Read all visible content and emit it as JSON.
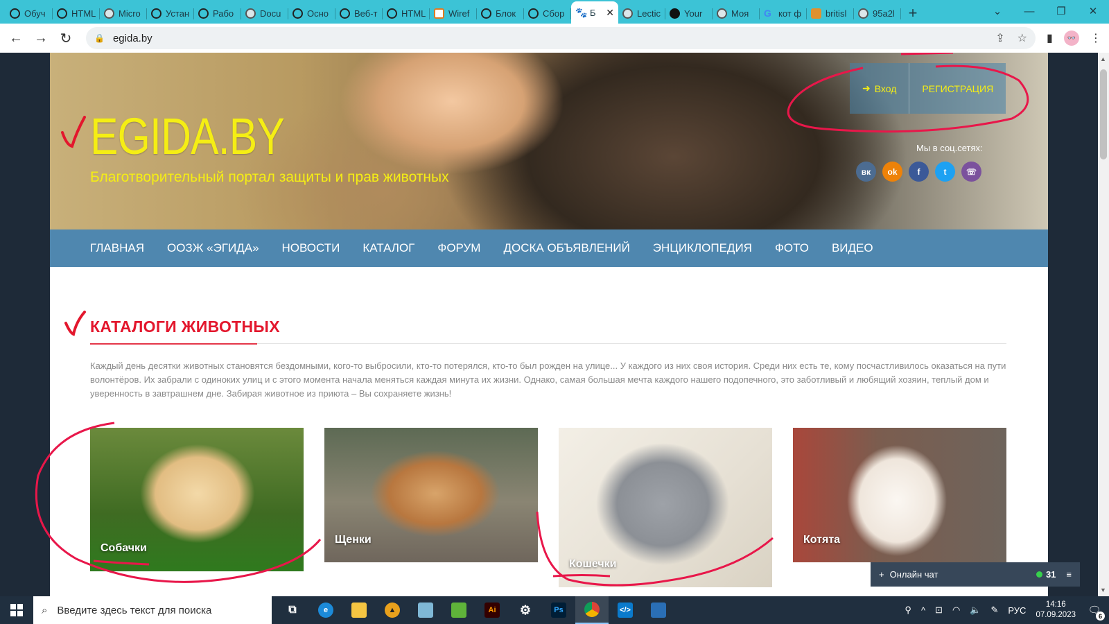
{
  "browser": {
    "tabs": [
      {
        "label": "Обуч",
        "icon": "openai-icon"
      },
      {
        "label": "HTML",
        "icon": "openai-icon"
      },
      {
        "label": "Micro",
        "icon": "globe-icon"
      },
      {
        "label": "Устан",
        "icon": "openai-icon"
      },
      {
        "label": "Рабо",
        "icon": "openai-icon"
      },
      {
        "label": "Docu",
        "icon": "globe-icon"
      },
      {
        "label": "Осно",
        "icon": "openai-icon"
      },
      {
        "label": "Веб-т",
        "icon": "openai-icon"
      },
      {
        "label": "HTML",
        "icon": "openai-icon"
      },
      {
        "label": "Wiref",
        "icon": "wireframe-icon"
      },
      {
        "label": "Блок",
        "icon": "openai-icon"
      },
      {
        "label": "Сбор",
        "icon": "openai-icon"
      },
      {
        "label": "Б",
        "icon": "paw-icon",
        "active": true
      },
      {
        "label": "Lectic",
        "icon": "globe-icon"
      },
      {
        "label": "Your",
        "icon": "github-icon"
      },
      {
        "label": "Моя",
        "icon": "globe-icon"
      },
      {
        "label": "кот ф",
        "icon": "google-icon"
      },
      {
        "label": "britisl",
        "icon": "tiger-icon"
      },
      {
        "label": "95a2l",
        "icon": "globe-icon"
      }
    ],
    "new_tab": "+",
    "url": "egida.by"
  },
  "site": {
    "logo": "EGIDA.BY",
    "tagline": "Благотворительный портал защиты и прав животных",
    "auth": {
      "login": "Вход",
      "register": "РЕГИСТРАЦИЯ"
    },
    "social_label": "Мы в соц.сетях:",
    "social": [
      {
        "name": "vk",
        "glyph": "вк",
        "color": "#4c6c91"
      },
      {
        "name": "odnoklassniki",
        "glyph": "ok",
        "color": "#ee8208"
      },
      {
        "name": "facebook",
        "glyph": "f",
        "color": "#3b5998"
      },
      {
        "name": "twitter",
        "glyph": "t",
        "color": "#1da1f2"
      },
      {
        "name": "viber",
        "glyph": "☏",
        "color": "#7b519d"
      }
    ],
    "menu": [
      "ГЛАВНАЯ",
      "ООЗЖ «ЭГИДА»",
      "НОВОСТИ",
      "КАТАЛОГ",
      "ФОРУМ",
      "ДОСКА ОБЪЯВЛЕНИЙ",
      "ЭНЦИКЛОПЕДИЯ",
      "ФОТО",
      "ВИДЕО"
    ],
    "section_title": "КАТАЛОГИ ЖИВОТНЫХ",
    "intro": "Каждый день десятки животных становятся бездомными, кого-то выбросили, кто-то потерялся, кто-то был рожден на улице... У каждого из них своя история. Среди них есть те, кому посчастливилось оказаться на пути волонтёров. Их забрали с одиноких улиц и с этого момента начала меняться каждая минута их жизни. Однако, самая большая мечта каждого нашего подопечного, это заботливый и любящий хозяин, теплый дом и уверенность в завтрашнем дне. Забирая животное из приюта – Вы сохраняете жизнь!",
    "cards": [
      {
        "label": "Собачки"
      },
      {
        "label": "Щенки"
      },
      {
        "label": "Кошечки"
      },
      {
        "label": "Котята"
      }
    ],
    "chat": {
      "label": "Онлайн чат",
      "count": "31"
    },
    "colors": {
      "accent_red": "#e3172d",
      "logo_yellow": "#f5ee14",
      "menu_blue": "#407da8"
    }
  },
  "taskbar": {
    "search_placeholder": "Введите здесь текст для поиска",
    "lang": "РУС",
    "time": "14:16",
    "date": "07.09.2023",
    "notifications": "6"
  }
}
